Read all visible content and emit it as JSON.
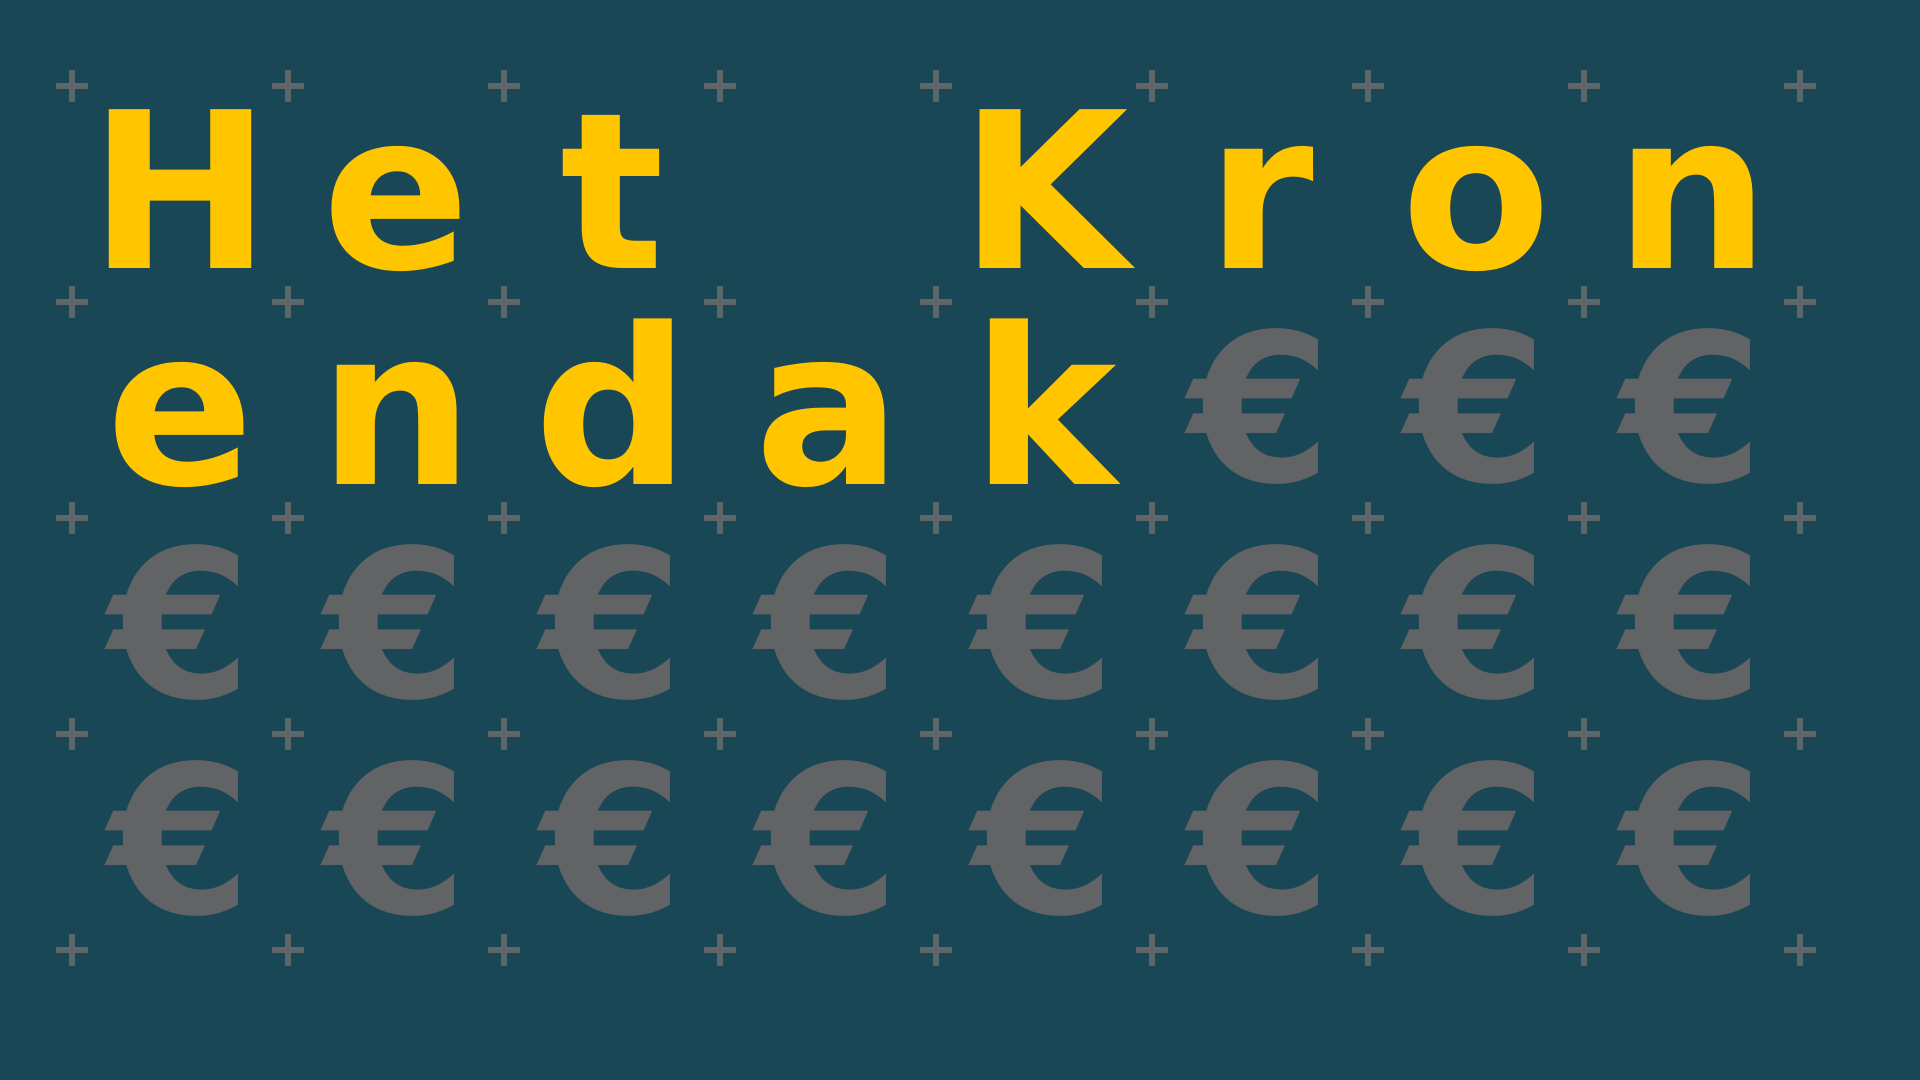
{
  "title": "Het Kronendak",
  "grid": {
    "columns": 8,
    "rows": 4,
    "cells": [
      "H",
      "e",
      "t",
      " ",
      "K",
      "r",
      "o",
      "n",
      "e",
      "n",
      "d",
      "a",
      "k",
      "€",
      "€",
      "€",
      "€",
      "€",
      "€",
      "€",
      "€",
      "€",
      "€",
      "€",
      "€",
      "€",
      "€",
      "€",
      "€",
      "€",
      "€",
      "€"
    ]
  },
  "colors": {
    "background": "#194755",
    "letter": "#ffc600",
    "symbol": "#626365",
    "plus": "#5e6667"
  },
  "icons": {
    "grid_marker": "plus-icon",
    "currency": "euro-sign-icon"
  }
}
